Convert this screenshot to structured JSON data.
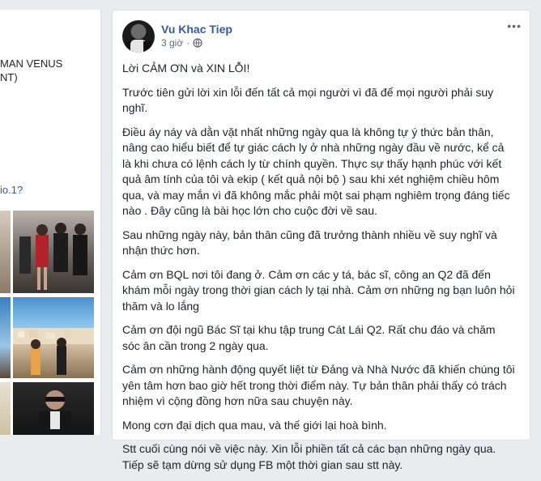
{
  "sidebar": {
    "text_line1": "MAN VENUS",
    "text_line2": "NT)",
    "link_text": "io.1?"
  },
  "post": {
    "author": "Vu Khac Tiep",
    "time": "3 giờ",
    "separator": "·",
    "privacy_icon": "globe-icon",
    "more_icon": "more-options-icon",
    "more_label": "•••",
    "paragraphs": [
      "Lời CẢM ƠN và XIN LỖI!",
      "Trước tiên gửi lời xin lỗi đến tất cả mọi người vì đã để mọi người phải suy nghĩ.",
      "Điều áy náy và dằn vặt nhất những ngày qua là không tự ý thức bản thân, nâng cao hiểu biết để tự giác cách ly ở nhà những ngày đầu về nước, kể cả là khi chưa có lệnh cách ly từ chính quyền. Thực sự thấy hạnh phúc với kết quả âm tính của tôi và ekip ( kết quả nội bộ ) sau khi xét nghiệm chiều hôm qua, và may mắn vì đã không mắc phải một sai phạm nghiêm trọng đáng tiếc nào . Đây cũng là bài học lớn cho cuộc đời về sau.",
      "Sau những ngày này, bản thân cũng đã trưởng thành nhiều về suy nghĩ và nhận thức hơn.",
      "Cảm ơn BQL nơi tôi đang ở. Cảm ơn các y tá, bác sĩ, công an Q2 đã đến khám mỗi ngày trong thời gian cách ly tại nhà. Cảm ơn những ng bạn luôn hỏi thăm và lo lắng",
      "Cảm ơn đội ngũ Bác Sĩ tại khu tập trung Cát Lái Q2. Rất chu đáo và chăm sóc ân cần trong 2 ngày qua.",
      "Cảm ơn những hành động quyết liệt từ Đảng và Nhà Nước đã khiến chúng tôi yên tâm hơn bao giờ hết trong thời điểm này. Tự bản thân phải thấy có trách nhiệm vì cộng đồng hơn nữa sau chuyện này.",
      "Mong cơn đại dịch qua mau, và thế giới lại hoà bình.",
      "Stt cuối cùng nói về việc này. Xin lỗi phiền tất cả các bạn những ngày qua. Tiếp sẽ tạm dừng sử dụng FB một thời gian sau stt này."
    ]
  },
  "colors": {
    "background": "#e9ebee",
    "link": "#385898",
    "meta": "#616770"
  }
}
